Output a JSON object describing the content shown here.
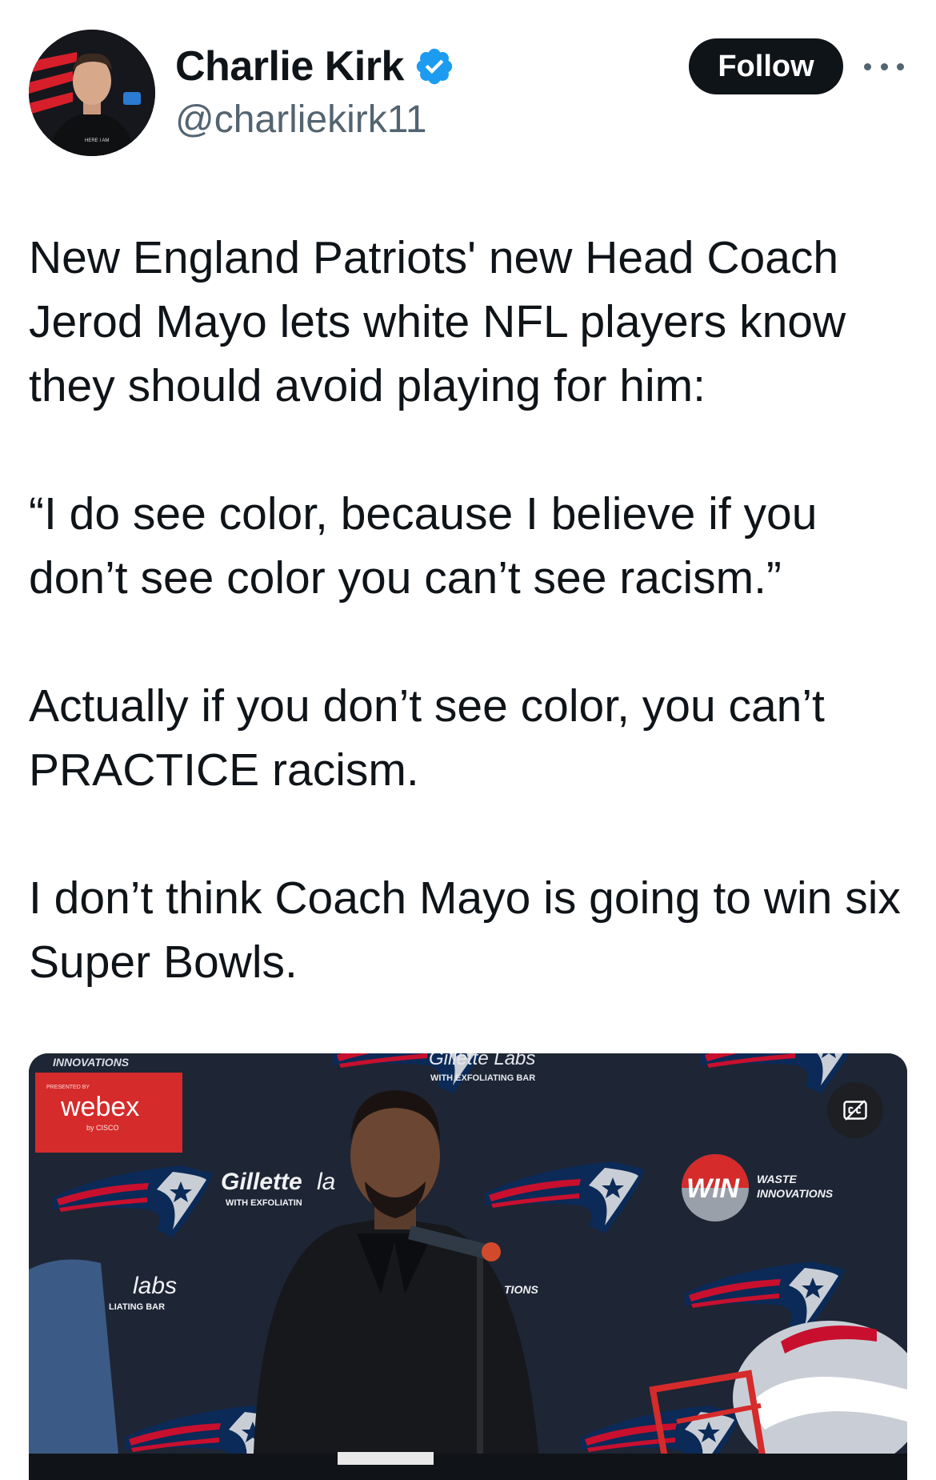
{
  "author": {
    "display_name": "Charlie Kirk",
    "handle": "@charliekirk11",
    "verified": true,
    "avatar_icon": "profile-photo",
    "avatar_shirt_text": "HERE I AM"
  },
  "actions": {
    "follow_label": "Follow",
    "more_icon": "ellipsis-icon"
  },
  "tweet": {
    "paragraphs": [
      "New England Patriots' new Head Coach Jerod Mayo lets white NFL players know they should avoid playing for him:",
      "“I do see color, because I believe if you don’t see color you can’t see racism.”",
      "Actually if you don’t see color, you can’t PRACTICE racism.",
      "I don’t think Coach Mayo is going to win six Super Bowls."
    ]
  },
  "media": {
    "type": "video",
    "captions_icon": "closed-captions-icon",
    "backdrop_text": {
      "webex_logo": "webex",
      "webex_sub": "by CISCO",
      "presented_by": "PRESENTED BY",
      "win_innovations": "INNOVATIONS",
      "gillette_top": "Gillette Labs",
      "gillette_top_sub": "WITH EXFOLIATING BAR",
      "gillette_mid": "Gillette",
      "gillette_mid_tail": "la",
      "gillette_mid_sub": "WITH EXFOLIATIN",
      "win_logo": "WIN",
      "waste": "WASTE",
      "innovations": "INNOVATIONS",
      "labs_left": "labs",
      "labs_left_sub": "LIATING BAR",
      "tions": "TIONS"
    },
    "colors": {
      "backdrop": "#1e2534",
      "patriots_red": "#c8102e",
      "patriots_navy": "#0b2a57",
      "webex_red": "#d52b2b"
    }
  }
}
